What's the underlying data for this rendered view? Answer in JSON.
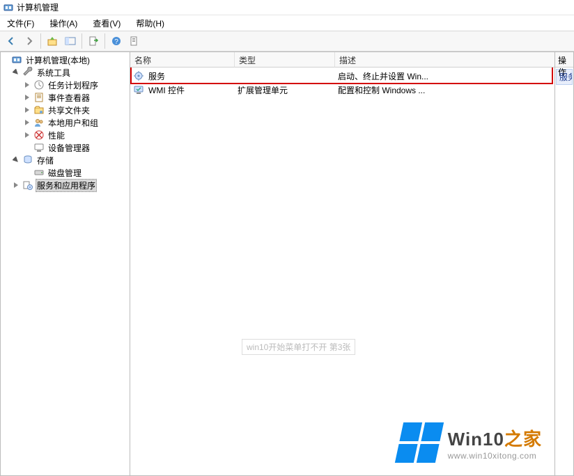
{
  "window": {
    "title": "计算机管理"
  },
  "menu": {
    "file": "文件(F)",
    "action": "操作(A)",
    "view": "查看(V)",
    "help": "帮助(H)"
  },
  "tree": {
    "root": "计算机管理(本地)",
    "system_tools": "系统工具",
    "system_tools_children": {
      "task_scheduler": "任务计划程序",
      "event_viewer": "事件查看器",
      "shared_folders": "共享文件夹",
      "local_users": "本地用户和组",
      "performance": "性能",
      "device_manager": "设备管理器"
    },
    "storage": "存储",
    "storage_children": {
      "disk_mgmt": "磁盘管理"
    },
    "services_apps": "服务和应用程序"
  },
  "list": {
    "headers": {
      "name": "名称",
      "type": "类型",
      "desc": "描述"
    },
    "rows": [
      {
        "name": "服务",
        "type": "",
        "desc": "启动、终止并设置 Win..."
      },
      {
        "name": "WMI 控件",
        "type": "扩展管理单元",
        "desc": "配置和控制 Windows ..."
      }
    ]
  },
  "action_pane": {
    "header": "操作",
    "group": "服务"
  },
  "watermark": {
    "center": "win10开始菜单打不开 第3张"
  },
  "branding": {
    "text_main": "Win10",
    "text_accent": "之家",
    "url": "www.win10xitong.com"
  }
}
